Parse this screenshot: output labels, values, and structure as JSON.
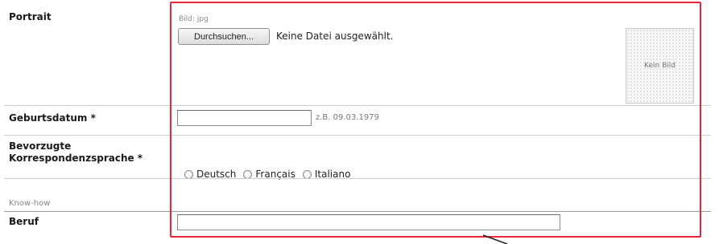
{
  "portrait": {
    "label": "Portrait",
    "format_hint": "Bild: jpg",
    "browse_button": "Durchsuchen...",
    "no_file_text": "Keine Datei ausgewählt.",
    "preview_text": "Kein Bild"
  },
  "birthdate": {
    "label": "Geburtsdatum *",
    "value": "",
    "hint": "z.B. 09.03.1979"
  },
  "language": {
    "label_line1": "Bevorzugte",
    "label_line2": "Korrespondenzsprache *",
    "options": [
      "Deutsch",
      "Français",
      "Italiano"
    ]
  },
  "knowhow": {
    "section_title": "Know-how"
  },
  "profession": {
    "label": "Beruf",
    "value": ""
  },
  "colors": {
    "highlight_frame": "#e8283a",
    "divider": "#cfcfcf"
  }
}
